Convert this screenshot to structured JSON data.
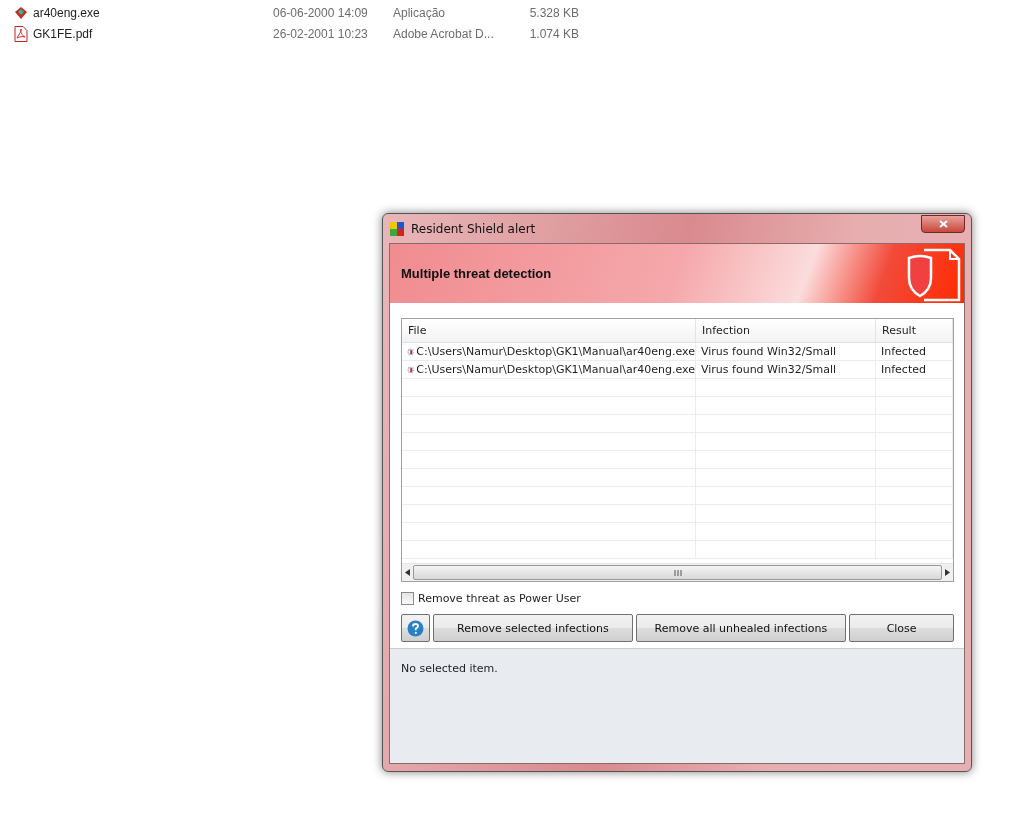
{
  "files": [
    {
      "kind": "exe",
      "name": "ar40eng.exe",
      "date": "06-06-2000 14:09",
      "type": "Aplicação",
      "size": "5.328 KB"
    },
    {
      "kind": "pdf",
      "name": "GK1FE.pdf",
      "date": "26-02-2001 10:23",
      "type": "Adobe Acrobat D...",
      "size": "1.074 KB"
    }
  ],
  "dialog": {
    "title": "Resident Shield alert",
    "header": "Multiple threat detection",
    "table": {
      "columns": [
        "File",
        "Infection",
        "Result"
      ],
      "rows": [
        {
          "file": "C:\\Users\\Namur\\Desktop\\GK1\\Manual\\ar40eng.exe",
          "infection": "Virus found Win32/Small",
          "result": "Infected"
        },
        {
          "file": "C:\\Users\\Namur\\Desktop\\GK1\\Manual\\ar40eng.exe",
          "infection": "Virus found Win32/Small",
          "result": "Infected"
        }
      ]
    },
    "checkbox": {
      "label": "Remove threat as Power User",
      "checked": false
    },
    "buttons": [
      "Remove selected infections",
      "Remove all unhealed infections",
      "Close"
    ],
    "status": "No selected item."
  }
}
